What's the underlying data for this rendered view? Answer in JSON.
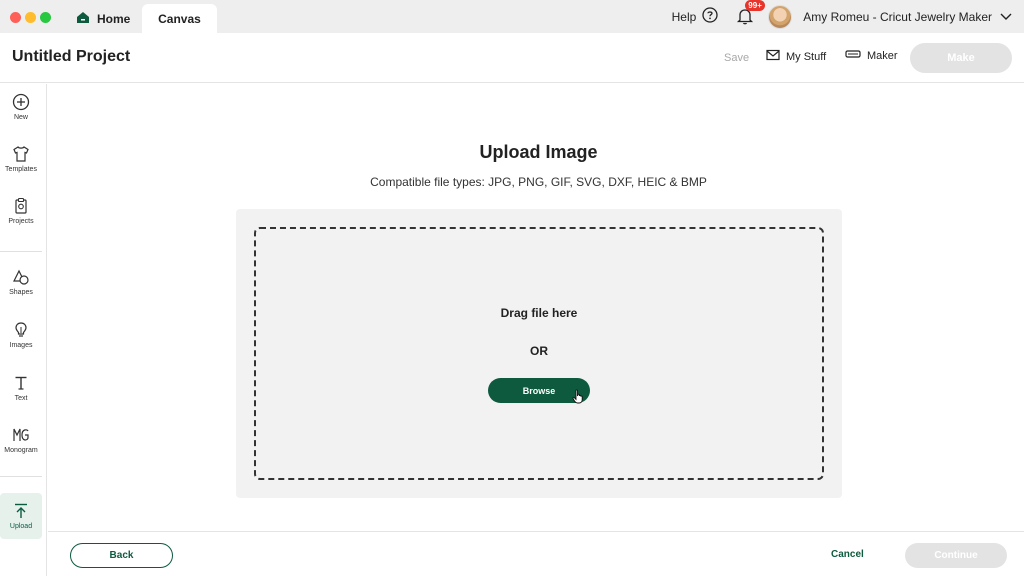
{
  "titlebar": {
    "tabs": [
      {
        "label": "Home",
        "icon": "home-icon"
      },
      {
        "label": "Canvas"
      }
    ],
    "help_label": "Help",
    "notifications_badge": "99+",
    "user_label": "Amy Romeu - Cricut Jewelry Maker"
  },
  "header": {
    "project_title": "Untitled Project",
    "save_label": "Save",
    "mystuff_label": "My Stuff",
    "maker_label": "Maker",
    "make_label": "Make"
  },
  "sidebar": {
    "items": [
      {
        "label": "New",
        "icon": "plus-circle-icon"
      },
      {
        "label": "Templates",
        "icon": "shirt-icon"
      },
      {
        "label": "Projects",
        "icon": "clipboard-icon"
      },
      {
        "label": "Shapes",
        "icon": "shapes-icon"
      },
      {
        "label": "Images",
        "icon": "lightbulb-icon"
      },
      {
        "label": "Text",
        "icon": "text-icon"
      },
      {
        "label": "Monogram",
        "icon": "monogram-icon"
      },
      {
        "label": "Upload",
        "icon": "upload-icon",
        "active": true
      }
    ]
  },
  "main": {
    "title": "Upload Image",
    "subtitle": "Compatible file types:  JPG, PNG, GIF, SVG, DXF, HEIC & BMP",
    "drag_text": "Drag file here",
    "or_text": "OR",
    "browse_label": "Browse"
  },
  "footer": {
    "back_label": "Back",
    "cancel_label": "Cancel",
    "continue_label": "Continue"
  },
  "colors": {
    "brand_green": "#0e5a3e",
    "disabled_gray": "#e3e3e3",
    "badge_red": "#e8342b"
  }
}
